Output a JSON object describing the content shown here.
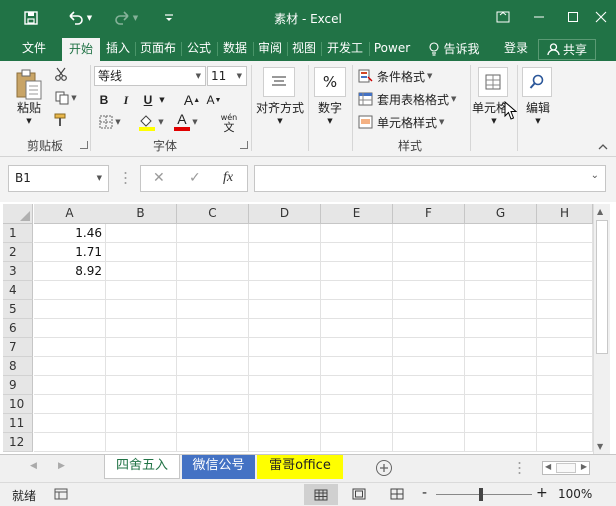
{
  "window": {
    "title": "素材 - Excel",
    "colors": {
      "brand": "#217346",
      "ribbon": "#f3f3f3"
    }
  },
  "quick_access": {
    "save_icon": "save-icon",
    "undo_icon": "undo-icon",
    "redo_icon": "redo-icon"
  },
  "tabs": [
    {
      "label": "文件"
    },
    {
      "label": "开始"
    },
    {
      "label": "插入"
    },
    {
      "label": "页面布"
    },
    {
      "label": "公式"
    },
    {
      "label": "数据"
    },
    {
      "label": "审阅"
    },
    {
      "label": "视图"
    },
    {
      "label": "开发工"
    },
    {
      "label": "Power"
    }
  ],
  "tell_me": "告诉我",
  "login": "登录",
  "share": "共享",
  "ribbon": {
    "clipboard": {
      "paste": "粘贴",
      "label": "剪贴板"
    },
    "font": {
      "name": "等线",
      "size": "11",
      "label": "字体",
      "bold": "B",
      "italic": "I",
      "underline": "U",
      "grow": "A",
      "shrink": "A",
      "color": "A",
      "phonetic_top": "wén",
      "phonetic_bottom": "文"
    },
    "alignment": {
      "label": "对齐方式"
    },
    "number": {
      "label": "数字",
      "symbol": "%"
    },
    "styles": {
      "conditional": "条件格式",
      "table": "套用表格格式",
      "cell": "单元格样式",
      "label": "样式"
    },
    "cells": {
      "label": "单元格"
    },
    "editing": {
      "label": "编辑"
    }
  },
  "formula_bar": {
    "name_box": "B1",
    "cancel": "✕",
    "enter": "✓",
    "fx": "fx",
    "formula": ""
  },
  "sheet": {
    "columns": [
      "A",
      "B",
      "C",
      "D",
      "E",
      "F",
      "G",
      "H"
    ],
    "rows": [
      "1",
      "2",
      "3",
      "4",
      "5",
      "6",
      "7",
      "8",
      "9",
      "10",
      "11",
      "12"
    ],
    "cells": {
      "A1": "1.46",
      "A2": "1.71",
      "A3": "8.92"
    }
  },
  "sheet_tabs": [
    {
      "label": "四舍五入",
      "bg": "#ffffff",
      "color": "#217346"
    },
    {
      "label": "微信公号",
      "bg": "#4472c4",
      "color": "#ffffff"
    },
    {
      "label": "雷哥office",
      "bg": "#ffff00",
      "color": "#222222"
    }
  ],
  "status": {
    "ready": "就绪",
    "zoom": "100%",
    "zoom_minus": "-",
    "zoom_plus": "+"
  }
}
